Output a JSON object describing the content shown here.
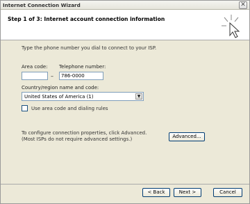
{
  "window": {
    "title": "Internet Connection Wizard",
    "close_glyph": "✕"
  },
  "header": {
    "step_title": "Step 1 of 3: Internet account connection information",
    "icon": "sparkle-cursor-icon"
  },
  "form": {
    "instruction": "Type the phone number you dial to connect to your ISP.",
    "area_code_label": "Area code:",
    "area_code_value": "",
    "dash": "–",
    "telephone_label": "Telephone number:",
    "telephone_value": "786-0000",
    "country_label": "Country/region name and code:",
    "country_value": "United States of America (1)",
    "dropdown_arrow": "▼",
    "checkbox_label": "Use area code and dialing rules",
    "configure_text_line1": "To configure connection properties, click Advanced.",
    "configure_text_line2": "(Most ISPs do not require advanced settings.)",
    "advanced_button": "Advanced..."
  },
  "buttons": {
    "back": "< Back",
    "next": "Next >",
    "cancel": "Cancel"
  }
}
